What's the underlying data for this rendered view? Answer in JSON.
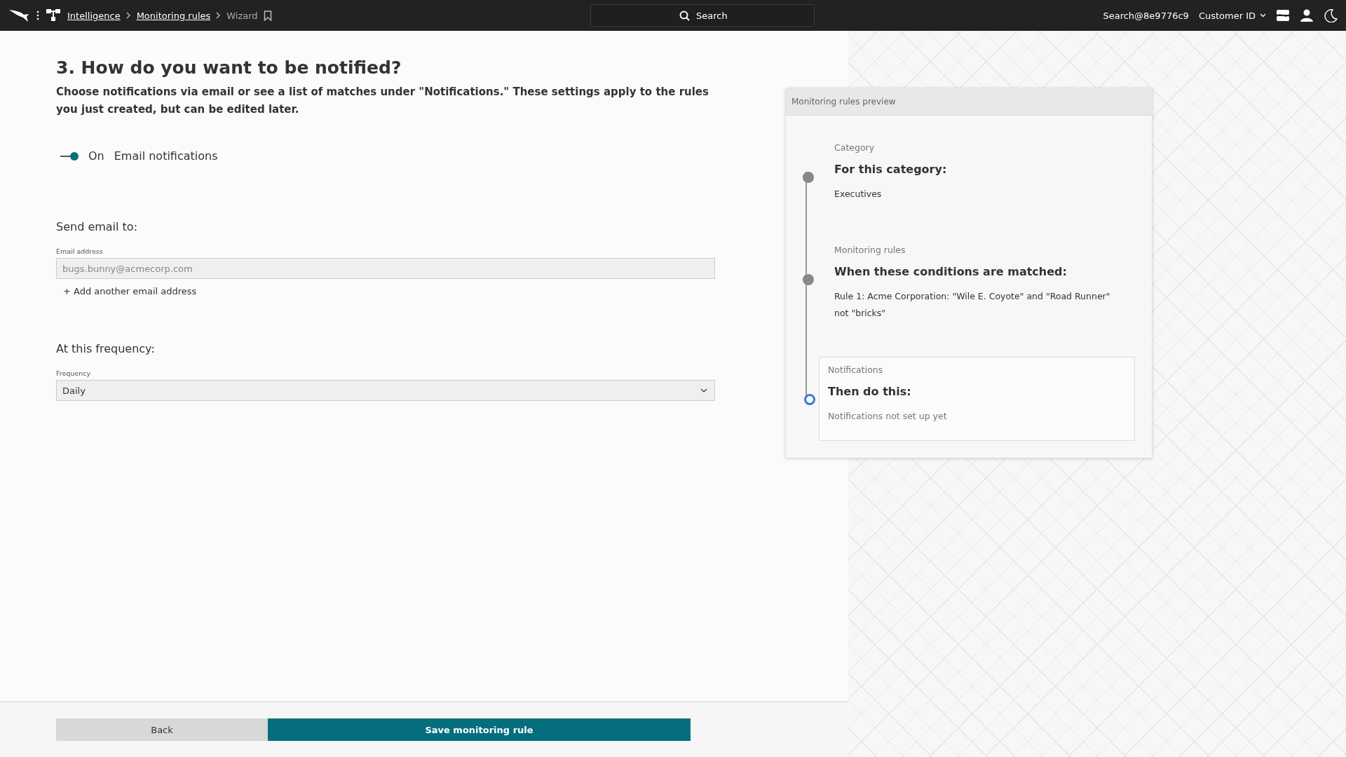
{
  "top_bar": {
    "breadcrumbs": [
      {
        "label": "Intelligence",
        "link": true
      },
      {
        "label": "Monitoring rules",
        "link": true
      },
      {
        "label": "Wizard",
        "link": false
      }
    ],
    "search": {
      "placeholder": "Search"
    },
    "user": "Search@8e9776c9",
    "customer": "Customer ID"
  },
  "form": {
    "heading": "3. How do you want to be notified?",
    "description": "Choose notifications via email or see a list of matches under \"Notifications.\" These settings apply to the rules you just created, but can be edited later.",
    "toggle": {
      "on": true,
      "state_label": "On",
      "label": "Email notifications"
    },
    "email_section": {
      "title": "Send email to:",
      "field_label": "Email address",
      "placeholder": "bugs.bunny@acmecorp.com",
      "add_link": "+ Add another email address"
    },
    "frequency_section": {
      "title": "At this frequency:",
      "field_label": "Frequency",
      "value": "Daily"
    }
  },
  "footer": {
    "back": "Back",
    "save": "Save monitoring rule"
  },
  "preview": {
    "title": "Monitoring rules preview",
    "steps": [
      {
        "label": "Category",
        "title": "For this category:",
        "text": "Executives",
        "current": false
      },
      {
        "label": "Monitoring rules",
        "title": "When these conditions are matched:",
        "text": "Rule 1: Acme Corporation: \"Wile E. Coyote\" and \"Road Runner\" not \"bricks\"",
        "current": false
      },
      {
        "label": "Notifications",
        "title": "Then do this:",
        "text": "Notifications not set up yet",
        "current": true
      }
    ]
  }
}
